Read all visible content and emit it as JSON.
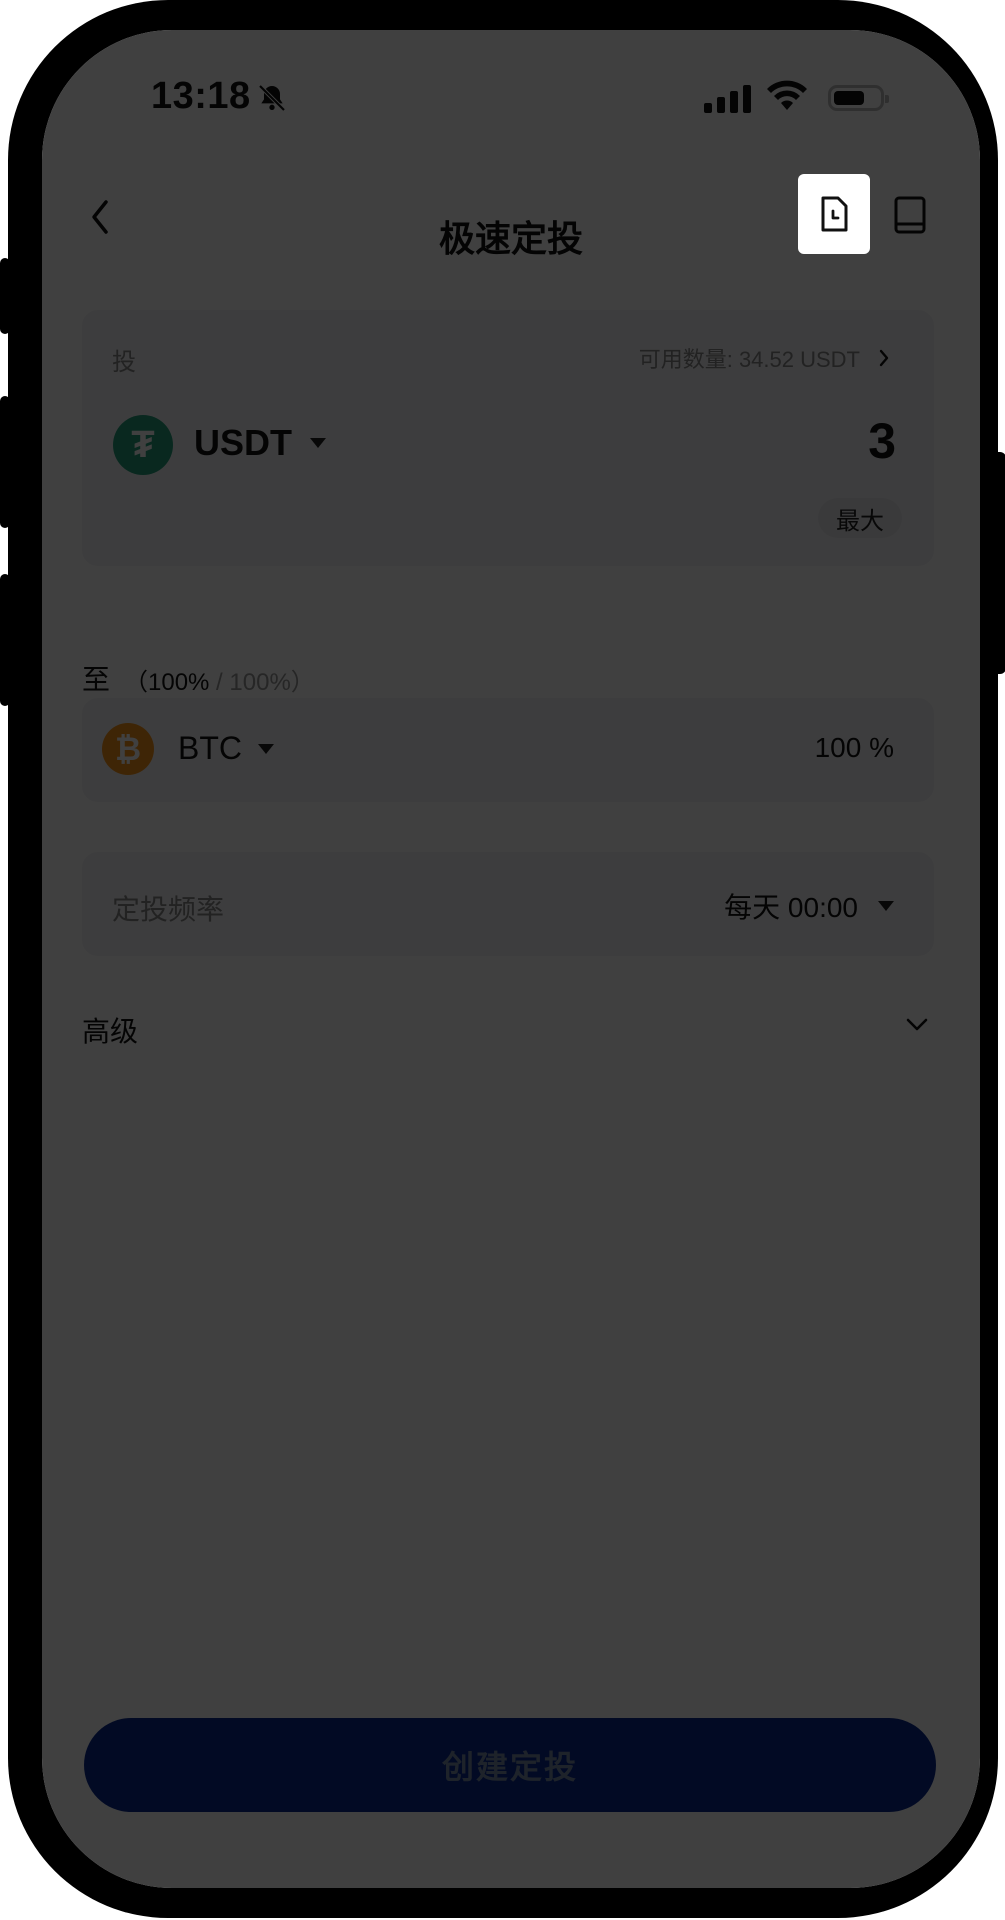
{
  "status_bar": {
    "time": "13:18"
  },
  "header": {
    "title": "极速定投"
  },
  "invest": {
    "label": "投",
    "available": "可用数量: 34.52 USDT",
    "coin": "USDT",
    "coin_symbol": "₮",
    "amount": "3",
    "max_label": "最大"
  },
  "target": {
    "label": "至",
    "pct_left": "（100%",
    "pct_right": " / 100%）",
    "coin": "BTC",
    "coin_symbol": "₿",
    "allocation": "100 %"
  },
  "frequency": {
    "label": "定投频率",
    "value": "每天 00:00"
  },
  "advanced": {
    "label": "高级"
  },
  "cta": {
    "label": "创建定投"
  },
  "colors": {
    "usdt": "#26a17b",
    "btc": "#f7931a",
    "cta": "#0a2a8f"
  }
}
